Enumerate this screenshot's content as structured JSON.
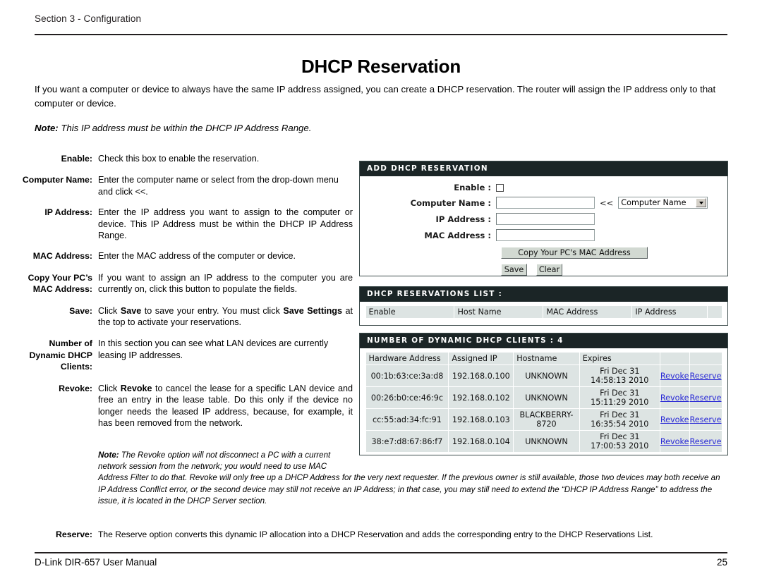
{
  "page": {
    "section_label": "Section 3 - Configuration",
    "title": "DHCP Reservation",
    "intro": "If you want a computer or device to always have the same IP address assigned, you can create a DHCP reservation. The router will assign the IP address only to that computer or device.",
    "note_prefix": "Note:",
    "note_text": " This IP address must be within the DHCP IP Address Range."
  },
  "descriptions": [
    {
      "term": "Enable:",
      "text": "Check this box to enable the reservation."
    },
    {
      "term": "Computer Name:",
      "text": "Enter the computer name or select from the drop-down menu and click <<."
    },
    {
      "term": "IP Address:",
      "text": "Enter the IP address you want to assign to the computer or device. This IP Address must be within the DHCP IP Address Range."
    },
    {
      "term": "MAC Address:",
      "text": "Enter the MAC address of the computer or device."
    },
    {
      "term": "Copy Your PC’s MAC Address:",
      "text": "If you want to assign an IP address to the computer you are currently on, click this button to populate the fields."
    },
    {
      "term": "Save:",
      "text_parts": [
        "Click ",
        "Save",
        " to save your entry. You must click ",
        "Save Settings",
        " at the top to activate your reservations."
      ]
    },
    {
      "term": "Number of Dynamic DHCP Clients:",
      "text": "In this section you can see what LAN devices are currently leasing IP addresses."
    },
    {
      "term": "Revoke:",
      "text_parts": [
        "Click ",
        "Revoke",
        " to cancel the lease for a specific LAN device and free an entry in the lease table. Do this only if the device no longer needs the leased IP address, because, for example, it has been removed from the network."
      ]
    }
  ],
  "revoke_note": {
    "prefix": "Note:",
    "line1": " The Revoke option will not disconnect a PC with a current",
    "line2": "network session from the network; you would need to use MAC",
    "rest": "Address Filter to do that. Revoke will only free up a DHCP Address for the very next requester. If the previous owner is still available, those two devices may both receive an IP Address Conflict error, or the second device may still not receive an IP Address; in that case, you may still need to extend the “DHCP IP Address Range” to address the issue, it is located in the DHCP Server section."
  },
  "reserve": {
    "term": "Reserve:",
    "text": "The Reserve option converts this dynamic IP allocation into a DHCP Reservation and adds the corresponding entry to the DHCP Reservations List."
  },
  "footer": {
    "manual": "D-Link DIR-657 User Manual",
    "page_number": "25"
  },
  "ui": {
    "add_panel": {
      "title": "ADD DHCP RESERVATION",
      "fields": {
        "enable_label": "Enable :",
        "computer_name_label": "Computer Name :",
        "computer_name_value": "",
        "ip_address_label": "IP Address :",
        "ip_address_value": "",
        "mac_address_label": "MAC Address :",
        "mac_address_value": "",
        "arrows": "<<",
        "dropdown_selected": "Computer Name"
      },
      "buttons": {
        "copy_mac": "Copy Your PC's MAC Address",
        "save": "Save",
        "clear": "Clear"
      }
    },
    "reservations_panel": {
      "title": "DHCP RESERVATIONS LIST :",
      "columns": [
        "Enable",
        "Host Name",
        "MAC Address",
        "IP Address"
      ],
      "rows": []
    },
    "clients_panel": {
      "title": "NUMBER OF DYNAMIC DHCP CLIENTS : 4",
      "columns": [
        "Hardware Address",
        "Assigned IP",
        "Hostname",
        "Expires"
      ],
      "rows": [
        {
          "hardware_address": "00:1b:63:ce:3a:d8",
          "assigned_ip": "192.168.0.100",
          "hostname": "UNKNOWN",
          "expires": "Fri Dec 31 14:58:13 2010",
          "revoke": "Revoke",
          "reserve": "Reserve"
        },
        {
          "hardware_address": "00:26:b0:ce:46:9c",
          "assigned_ip": "192.168.0.102",
          "hostname": "UNKNOWN",
          "expires": "Fri Dec 31 15:11:29 2010",
          "revoke": "Revoke",
          "reserve": "Reserve"
        },
        {
          "hardware_address": "cc:55:ad:34:fc:91",
          "assigned_ip": "192.168.0.103",
          "hostname": "BLACKBERRY-8720",
          "expires": "Fri Dec 31 16:35:54 2010",
          "revoke": "Revoke",
          "reserve": "Reserve"
        },
        {
          "hardware_address": "38:e7:d8:67:86:f7",
          "assigned_ip": "192.168.0.104",
          "hostname": "UNKNOWN",
          "expires": "Fri Dec 31 17:00:53 2010",
          "revoke": "Revoke",
          "reserve": "Reserve"
        }
      ]
    }
  },
  "colors": {
    "titlebar_bg": "#1b2526",
    "table_cell_bg": "#dde4e3",
    "link": "#2b2bd6",
    "rule": "#231f20"
  }
}
